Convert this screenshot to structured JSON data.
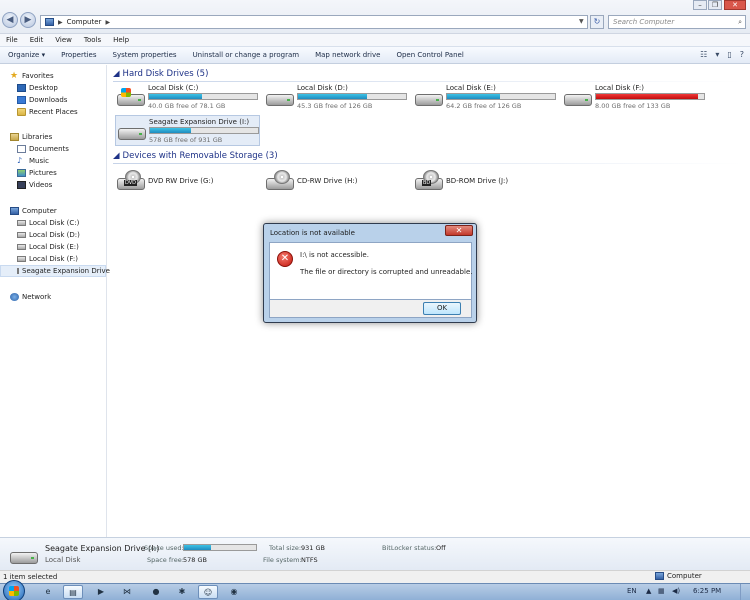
{
  "address": {
    "location": "Computer"
  },
  "search": {
    "placeholder": "Search Computer"
  },
  "menu": [
    "File",
    "Edit",
    "View",
    "Tools",
    "Help"
  ],
  "toolbar": [
    "Organize ▾",
    "Properties",
    "System properties",
    "Uninstall or change a program",
    "Map network drive",
    "Open Control Panel"
  ],
  "sidebar": {
    "favorites": "Favorites",
    "favorites_items": [
      "Desktop",
      "Downloads",
      "Recent Places"
    ],
    "libraries": "Libraries",
    "libraries_items": [
      "Documents",
      "Music",
      "Pictures",
      "Videos"
    ],
    "computer": "Computer",
    "computer_items": [
      "Local Disk (C:)",
      "Local Disk (D:)",
      "Local Disk (E:)",
      "Local Disk (F:)",
      "Seagate Expansion Drive"
    ],
    "network": "Network"
  },
  "groups": {
    "hdd_title": "Hard Disk Drives (5)",
    "removable_title": "Devices with Removable Storage (3)"
  },
  "drives": [
    {
      "name": "Local Disk (C:)",
      "free": "40.0 GB free of 78.1 GB",
      "used_fraction": 0.49,
      "warning": false
    },
    {
      "name": "Local Disk (D:)",
      "free": "45.3 GB free of 126 GB",
      "used_fraction": 0.64,
      "warning": false
    },
    {
      "name": "Local Disk (E:)",
      "free": "64.2 GB free of 126 GB",
      "used_fraction": 0.49,
      "warning": false
    },
    {
      "name": "Local Disk (F:)",
      "free": "8.00 GB free of 133 GB",
      "used_fraction": 0.94,
      "warning": true
    },
    {
      "name": "Seagate Expansion Drive (I:)",
      "free": "578 GB free of 931 GB",
      "used_fraction": 0.38,
      "warning": false
    }
  ],
  "removable": [
    {
      "name": "DVD RW Drive (G:)",
      "badge": "DVD"
    },
    {
      "name": "CD-RW Drive (H:)",
      "badge": ""
    },
    {
      "name": "BD-ROM Drive (J:)",
      "badge": "BD"
    }
  ],
  "dialog": {
    "title": "Location is not available",
    "close": "✕",
    "message1": "I:\\ is not accessible.",
    "message2": "The file or directory is corrupted and unreadable.",
    "ok": "OK"
  },
  "details": {
    "name": "Seagate Expansion Drive (I:)",
    "type": "Local Disk",
    "space_used_label": "Space used:",
    "space_used_fraction": 0.38,
    "space_free_label": "Space free:",
    "space_free_value": "578 GB",
    "total_size_label": "Total size:",
    "total_size_value": "931 GB",
    "filesystem_label": "File system:",
    "filesystem_value": "NTFS",
    "bitlocker_label": "BitLocker status:",
    "bitlocker_value": "Off"
  },
  "status": {
    "selection": "1 item selected",
    "location": "Computer"
  },
  "tray": {
    "lang": "EN",
    "time": "6:25 PM"
  },
  "colors": {
    "accent": "#1e3287",
    "bar_fill": "#26a0d0",
    "bar_warning": "#d21414"
  }
}
